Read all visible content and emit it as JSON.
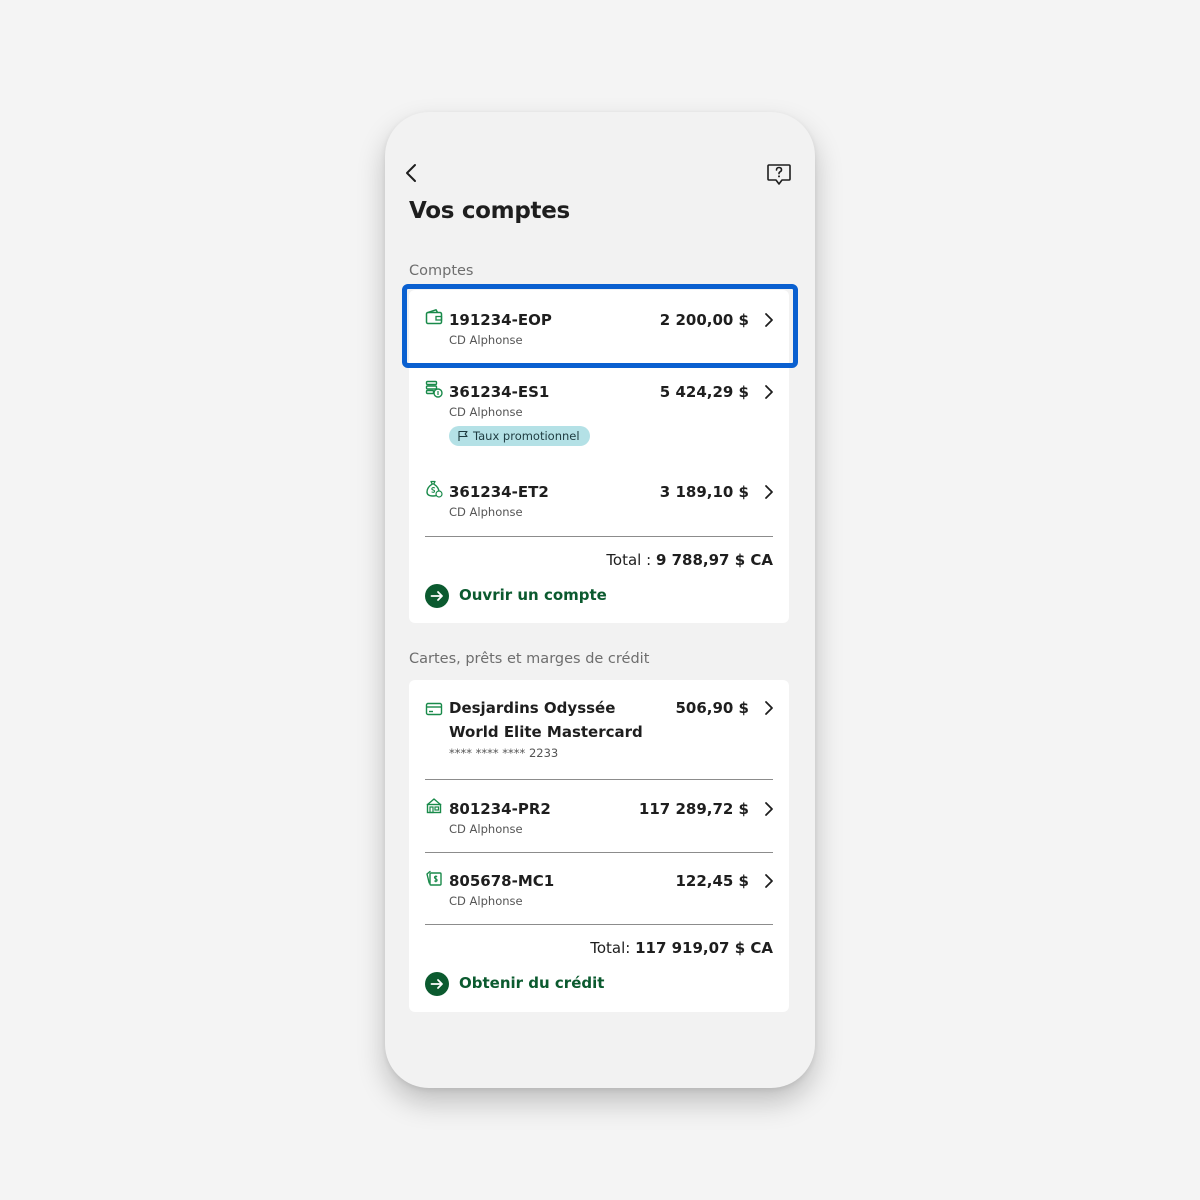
{
  "header": {
    "title": "Vos comptes",
    "back_icon": "chevron-left-icon",
    "help_icon": "chat-help-icon"
  },
  "accounts_section": {
    "label": "Comptes",
    "items": [
      {
        "number": "191234-EOP",
        "holder": "CD Alphonse",
        "amount": "2 200,00 $",
        "icon": "wallet-icon"
      },
      {
        "number": "361234-ES1",
        "holder": "CD Alphonse",
        "amount": "5 424,29 $",
        "icon": "savings-coins-icon",
        "badge": "Taux promotionnel"
      },
      {
        "number": "361234-ET2",
        "holder": "CD Alphonse",
        "amount": "3 189,10 $",
        "icon": "money-bag-icon"
      }
    ],
    "total_label": "Total :",
    "total_value": "9 788,97 $ CA",
    "action_label": "Ouvrir un compte"
  },
  "credit_section": {
    "label": "Cartes, prêts et marges de crédit",
    "items": [
      {
        "number": "Desjardins Odyssée World Elite Mastercard",
        "holder": "**** **** **** 2233",
        "amount": "506,90 $",
        "icon": "credit-card-icon"
      },
      {
        "number": "801234-PR2",
        "holder": "CD Alphonse",
        "amount": "117 289,72 $",
        "icon": "house-loan-icon"
      },
      {
        "number": "805678-MC1",
        "holder": "CD Alphonse",
        "amount": "122,45 $",
        "icon": "cash-credit-icon"
      }
    ],
    "total_label": "Total:",
    "total_value": "117 919,07 $ CA",
    "action_label": "Obtenir du crédit"
  },
  "colors": {
    "brand_green": "#0b5a2f",
    "icon_green": "#198a4a",
    "highlight_blue": "#0a60d0",
    "badge_bg": "#b4e1e6"
  }
}
